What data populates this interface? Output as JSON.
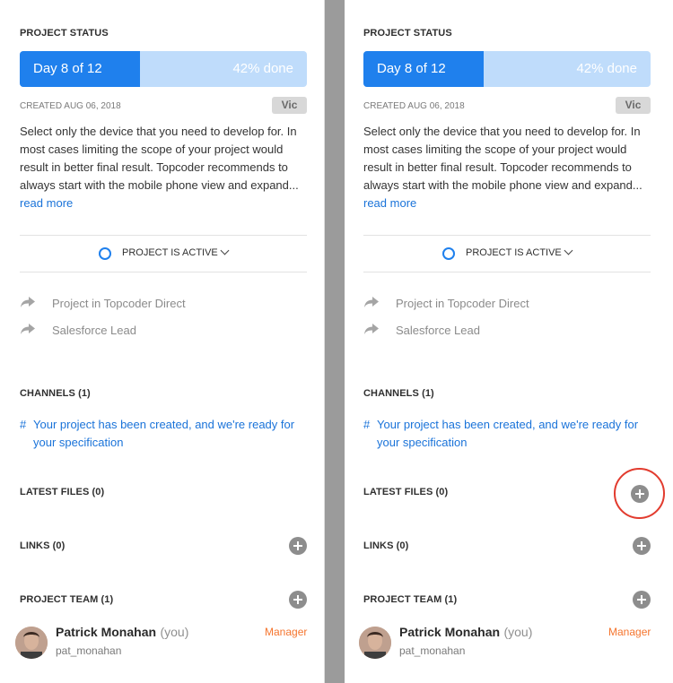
{
  "panels": [
    {
      "project_status_title": "PROJECT STATUS",
      "progress": {
        "day_label": "Day 8 of 12",
        "done_label": "42% done",
        "fraction": 0.42,
        "fill_color": "#1f80ed",
        "track_color": "#bfdcfb"
      },
      "created": "CREATED AUG 06, 2018",
      "owner_badge": "Vic",
      "description": [
        "Select only the device that you need to develop for. In",
        "most cases limiting the scope of your project would",
        "result in better final result. Topcoder recommends to",
        "always start with the mobile phone view and expand..."
      ],
      "read_more": "read more",
      "status_label": "PROJECT IS ACTIVE",
      "external_links": [
        "Project in Topcoder Direct",
        "Salesforce Lead"
      ],
      "channels_title": "CHANNELS (1)",
      "channel_hash": "#",
      "channel_text": [
        "Your project has been created, and we're ready for",
        "your specification"
      ],
      "latest_files_title": "LATEST FILES (0)",
      "links_title": "LINKS (0)",
      "team_title": "PROJECT TEAM (1)",
      "member": {
        "name": "Patrick Monahan",
        "you": "(you)",
        "handle": "pat_monahan",
        "role": "Manager"
      }
    },
    {
      "project_status_title": "PROJECT STATUS",
      "progress": {
        "day_label": "Day 8 of 12",
        "done_label": "42% done",
        "fraction": 0.42,
        "fill_color": "#1f80ed",
        "track_color": "#bfdcfb"
      },
      "created": "CREATED AUG 06, 2018",
      "owner_badge": "Vic",
      "description": [
        "Select only the device that you need to develop for. In",
        "most cases limiting the scope of your project would",
        "result in better final result. Topcoder recommends to",
        "always start with the mobile phone view and expand..."
      ],
      "read_more": "read more",
      "status_label": "PROJECT IS ACTIVE",
      "external_links": [
        "Project in Topcoder Direct",
        "Salesforce Lead"
      ],
      "channels_title": "CHANNELS (1)",
      "channel_hash": "#",
      "channel_text": [
        "Your project has been created, and we're ready for",
        "your specification"
      ],
      "latest_files_title": "LATEST FILES (0)",
      "links_title": "LINKS (0)",
      "team_title": "PROJECT TEAM (1)",
      "member": {
        "name": "Patrick Monahan",
        "you": "(you)",
        "handle": "pat_monahan",
        "role": "Manager"
      }
    }
  ],
  "highlight_color": "#e23b2e"
}
